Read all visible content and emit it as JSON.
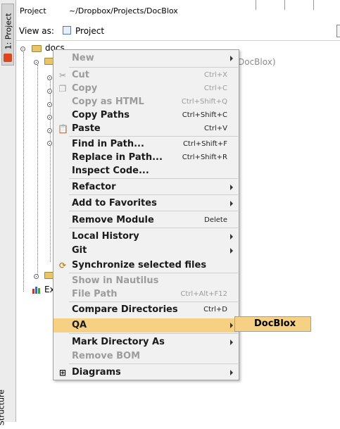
{
  "left_strip": {
    "project_tab": "1: Project",
    "structure_tab": "Structure"
  },
  "header": {
    "title": "Project",
    "path": "~/Dropbox/Projects/DocBlox"
  },
  "view_as": {
    "label": "View as:",
    "value": "Project"
  },
  "tree": {
    "root_label": "docs",
    "second_label_suffix": "DocBlox)",
    "ext_label": "Ex"
  },
  "context_menu": {
    "items": [
      {
        "label": "New",
        "shortcut": "",
        "submenu": true,
        "disabled": true
      },
      {
        "label": "Cut",
        "shortcut": "Ctrl+X",
        "icon": "scissors-icon",
        "disabled": true
      },
      {
        "label": "Copy",
        "shortcut": "Ctrl+C",
        "icon": "copy-icon",
        "disabled": true
      },
      {
        "label": "Copy as HTML",
        "shortcut": "Ctrl+Shift+Q",
        "disabled": true
      },
      {
        "label": "Copy Paths",
        "shortcut": "Ctrl+Shift+C"
      },
      {
        "label": "Paste",
        "shortcut": "Ctrl+V",
        "icon": "clipboard-icon"
      },
      {
        "label": "Find in Path...",
        "shortcut": "Ctrl+Shift+F"
      },
      {
        "label": "Replace in Path...",
        "shortcut": "Ctrl+Shift+R"
      },
      {
        "label": "Inspect Code...",
        "shortcut": ""
      },
      {
        "label": "Refactor",
        "submenu": true
      },
      {
        "label": "Add to Favorites",
        "submenu": true
      },
      {
        "label": "Remove Module",
        "shortcut": "Delete"
      },
      {
        "label": "Local History",
        "submenu": true
      },
      {
        "label": "Git",
        "submenu": true
      },
      {
        "label": "Synchronize selected files",
        "icon": "sync-icon"
      },
      {
        "label": "Show in Nautilus",
        "disabled": true
      },
      {
        "label": "File Path",
        "shortcut": "Ctrl+Alt+F12",
        "disabled": true
      },
      {
        "label": "Compare Directories",
        "shortcut": "Ctrl+D"
      },
      {
        "label": "QA",
        "submenu": true,
        "active": true
      },
      {
        "label": "Mark Directory As",
        "submenu": true
      },
      {
        "label": "Remove BOM",
        "disabled": true
      },
      {
        "label": "Diagrams",
        "submenu": true,
        "icon": "diagram-icon"
      }
    ]
  },
  "submenu": {
    "item": "DocBlox"
  },
  "colors": {
    "highlight": "#f6d184",
    "menu_bg": "#f1f1f1",
    "disabled_text": "#9c9c9c"
  }
}
